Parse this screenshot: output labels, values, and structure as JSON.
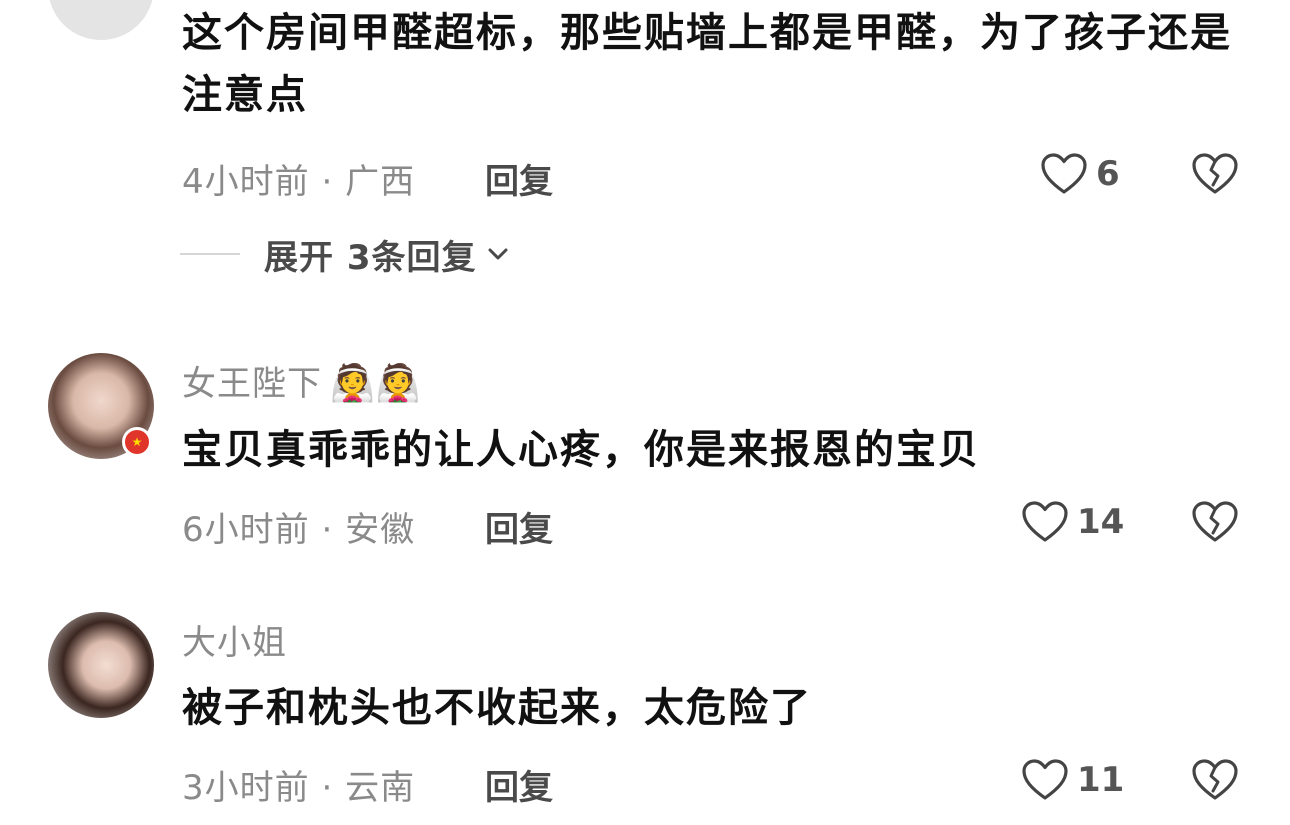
{
  "comments": [
    {
      "text": "这个房间甲醛超标，那些贴墙上都是甲醛，为了孩子还是注意点",
      "time": "4小时前",
      "location": "广西",
      "reply_label": "回复",
      "likes": "6",
      "expand_label": "展开 3条回复"
    },
    {
      "username": "女王陛下",
      "emoji": "👰👰",
      "text": "宝贝真乖乖的让人心疼，你是来报恩的宝贝",
      "time": "6小时前",
      "location": "安徽",
      "reply_label": "回复",
      "likes": "14"
    },
    {
      "username": "大小姐",
      "text": "被子和枕头也不收起来，太危险了",
      "time": "3小时前",
      "location": "云南",
      "reply_label": "回复",
      "likes": "11"
    }
  ],
  "separator": " · ",
  "icons": {
    "like": "heart-outline-icon",
    "dislike": "broken-heart-icon",
    "expand": "chevron-down-icon",
    "flag": "china-flag-icon"
  },
  "colors": {
    "text_primary": "#111111",
    "text_secondary": "#8a8a8a",
    "reply_text": "#4a4a4a"
  }
}
